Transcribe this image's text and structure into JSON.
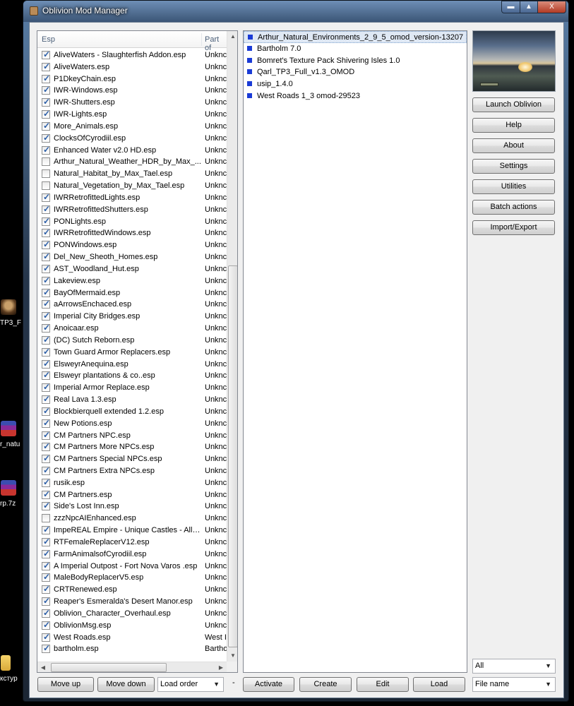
{
  "window": {
    "title": "Oblivion Mod Manager",
    "min_glyph": "▬",
    "max_glyph": "▲",
    "close_glyph": "X"
  },
  "desktop": {
    "labels": [
      "TP3_F",
      "r_natu",
      "rp.7z",
      "кстур"
    ]
  },
  "esp_list": {
    "columns": [
      "Esp",
      "Part of"
    ],
    "rows": [
      {
        "name": "AliveWaters - Slaughterfish Addon.esp",
        "part": "Unknc",
        "checked": true
      },
      {
        "name": "AliveWaters.esp",
        "part": "Unknc",
        "checked": true
      },
      {
        "name": "P1DkeyChain.esp",
        "part": "Unknc",
        "checked": true
      },
      {
        "name": "IWR-Windows.esp",
        "part": "Unknc",
        "checked": true
      },
      {
        "name": "IWR-Shutters.esp",
        "part": "Unknc",
        "checked": true
      },
      {
        "name": "IWR-Lights.esp",
        "part": "Unknc",
        "checked": true
      },
      {
        "name": "More_Animals.esp",
        "part": "Unknc",
        "checked": true
      },
      {
        "name": "ClocksOfCyrodiil.esp",
        "part": "Unknc",
        "checked": true
      },
      {
        "name": "Enhanced Water v2.0 HD.esp",
        "part": "Unknc",
        "checked": true
      },
      {
        "name": "Arthur_Natural_Weather_HDR_by_Max_...",
        "part": "Unknc",
        "checked": false
      },
      {
        "name": "Natural_Habitat_by_Max_Tael.esp",
        "part": "Unknc",
        "checked": false
      },
      {
        "name": "Natural_Vegetation_by_Max_Tael.esp",
        "part": "Unknc",
        "checked": false
      },
      {
        "name": "IWRRetrofittedLights.esp",
        "part": "Unknc",
        "checked": true
      },
      {
        "name": "IWRRetrofittedShutters.esp",
        "part": "Unknc",
        "checked": true
      },
      {
        "name": "PONLights.esp",
        "part": "Unknc",
        "checked": true
      },
      {
        "name": "IWRRetrofittedWindows.esp",
        "part": "Unknc",
        "checked": true
      },
      {
        "name": "PONWindows.esp",
        "part": "Unknc",
        "checked": true
      },
      {
        "name": "Del_New_Sheoth_Homes.esp",
        "part": "Unknc",
        "checked": true
      },
      {
        "name": "AST_Woodland_Hut.esp",
        "part": "Unknc",
        "checked": true
      },
      {
        "name": "Lakeview.esp",
        "part": "Unknc",
        "checked": true
      },
      {
        "name": "BayOfMermaid.esp",
        "part": "Unknc",
        "checked": true
      },
      {
        "name": "aArrowsEnchaced.esp",
        "part": "Unknc",
        "checked": true
      },
      {
        "name": "Imperial City Bridges.esp",
        "part": "Unknc",
        "checked": true
      },
      {
        "name": "Anoicaar.esp",
        "part": "Unknc",
        "checked": true
      },
      {
        "name": "(DC) Sutch Reborn.esp",
        "part": "Unknc",
        "checked": true
      },
      {
        "name": "Town Guard Armor Replacers.esp",
        "part": "Unknc",
        "checked": true
      },
      {
        "name": "ElsweyrAnequina.esp",
        "part": "Unknc",
        "checked": true
      },
      {
        "name": "Elsweyr plantations & co..esp",
        "part": "Unknc",
        "checked": true
      },
      {
        "name": "Imperial Armor Replace.esp",
        "part": "Unknc",
        "checked": true
      },
      {
        "name": "Real Lava 1.3.esp",
        "part": "Unknc",
        "checked": true
      },
      {
        "name": "Blockbierquell extended 1.2.esp",
        "part": "Unknc",
        "checked": true
      },
      {
        "name": "New Potions.esp",
        "part": "Unknc",
        "checked": true
      },
      {
        "name": "CM Partners NPC.esp",
        "part": "Unknc",
        "checked": true
      },
      {
        "name": "CM Partners More NPCs.esp",
        "part": "Unknc",
        "checked": true
      },
      {
        "name": "CM Partners Special NPCs.esp",
        "part": "Unknc",
        "checked": true
      },
      {
        "name": "CM Partners Extra NPCs.esp",
        "part": "Unknc",
        "checked": true
      },
      {
        "name": "rusik.esp",
        "part": "Unknc",
        "checked": true
      },
      {
        "name": "CM Partners.esp",
        "part": "Unknc",
        "checked": true
      },
      {
        "name": "Side's Lost Inn.esp",
        "part": "Unknc",
        "checked": true
      },
      {
        "name": "zzzNpcAIEnhanced.esp",
        "part": "Unknc",
        "checked": false
      },
      {
        "name": "ImpeREAL Empire - Unique Castles - All T...",
        "part": "Unknc",
        "checked": true
      },
      {
        "name": "RTFemaleReplacerV12.esp",
        "part": "Unknc",
        "checked": true
      },
      {
        "name": "FarmAnimalsofCyrodiil.esp",
        "part": "Unknc",
        "checked": true
      },
      {
        "name": "A Imperial Outpost - Fort Nova Varos .esp",
        "part": "Unknc",
        "checked": true
      },
      {
        "name": "MaleBodyReplacerV5.esp",
        "part": "Unknc",
        "checked": true
      },
      {
        "name": "CRTRenewed.esp",
        "part": "Unknc",
        "checked": true
      },
      {
        "name": "Reaper's Esmeralda's Desert Manor.esp",
        "part": "Unknc",
        "checked": true
      },
      {
        "name": "Oblivion_Character_Overhaul.esp",
        "part": "Unknc",
        "checked": true
      },
      {
        "name": "OblivionMsg.esp",
        "part": "Unknc",
        "checked": true
      },
      {
        "name": "West Roads.esp",
        "part": "West I",
        "checked": true
      },
      {
        "name": "bartholm.esp",
        "part": "Bartho",
        "checked": true
      }
    ]
  },
  "mod_list": [
    "Arthur_Natural_Environments_2_9_5_omod_version-13207",
    "Bartholm 7.0",
    "Bomret's Texture Pack Shivering Isles 1.0",
    "Qarl_TP3_Full_v1.3_OMOD",
    "usip_1.4.0",
    "West Roads 1_3 omod-29523"
  ],
  "side_buttons": {
    "launch": "Launch Oblivion",
    "help": "Help",
    "about": "About",
    "settings": "Settings",
    "utilities": "Utilities",
    "batch": "Batch actions",
    "import_export": "Import/Export"
  },
  "bottom": {
    "move_up": "Move up",
    "move_down": "Move down",
    "load_order_select": "Load order",
    "dash": "-",
    "activate": "Activate",
    "create": "Create",
    "edit": "Edit",
    "load": "Load",
    "filter_select": "All",
    "sort_select": "File name"
  },
  "glyphs": {
    "up": "▲",
    "down": "▼",
    "left": "◀",
    "right": "▶",
    "dropdown": "▼"
  }
}
